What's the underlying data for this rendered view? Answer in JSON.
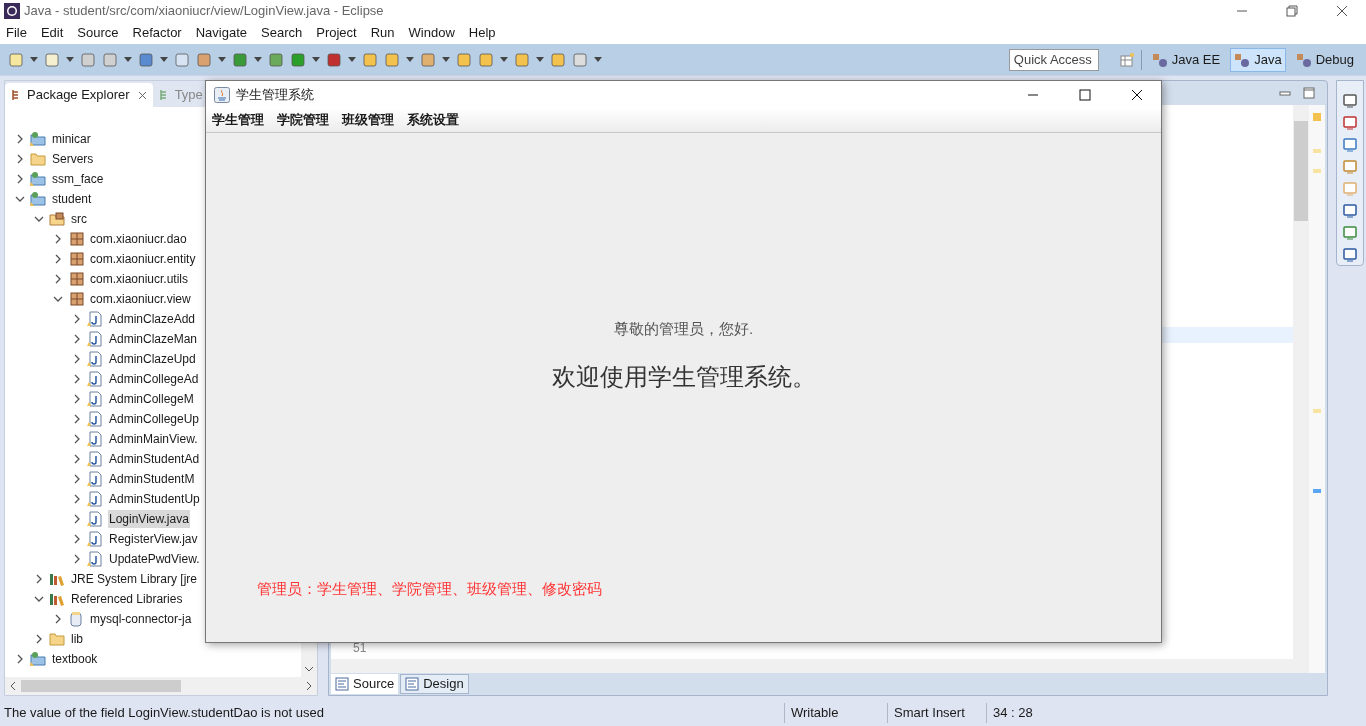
{
  "window": {
    "title": "Java - student/src/com/xiaoniucr/view/LoginView.java - Eclipse"
  },
  "menu": [
    "File",
    "Edit",
    "Source",
    "Refactor",
    "Navigate",
    "Search",
    "Project",
    "Run",
    "Window",
    "Help"
  ],
  "quick_access": {
    "placeholder": "Quick Access"
  },
  "perspectives": [
    {
      "label": "Java EE",
      "selected": false
    },
    {
      "label": "Java",
      "selected": true
    },
    {
      "label": "Debug",
      "selected": false
    }
  ],
  "package_explorer": {
    "tabs": [
      {
        "label": "Package Explorer",
        "selected": true
      },
      {
        "label": "Type",
        "selected": false
      }
    ],
    "tree": [
      {
        "label": "minicar",
        "kind": "project",
        "expanded": false,
        "selected": false
      },
      {
        "label": "Servers",
        "kind": "folder",
        "expanded": false,
        "selected": false
      },
      {
        "label": "ssm_face",
        "kind": "project",
        "expanded": false,
        "selected": false
      },
      {
        "label": "student",
        "kind": "project",
        "expanded": true,
        "selected": false,
        "children": [
          {
            "label": "src",
            "kind": "source_folder",
            "expanded": true,
            "selected": false,
            "children": [
              {
                "label": "com.xiaoniucr.dao",
                "kind": "package",
                "expanded": false,
                "selected": false
              },
              {
                "label": "com.xiaoniucr.entity",
                "kind": "package",
                "expanded": false,
                "selected": false
              },
              {
                "label": "com.xiaoniucr.utils",
                "kind": "package",
                "expanded": false,
                "selected": false
              },
              {
                "label": "com.xiaoniucr.view",
                "kind": "package",
                "expanded": true,
                "selected": false,
                "children": [
                  {
                    "label": "AdminClazeAdd",
                    "kind": "java_file",
                    "expanded": false,
                    "selected": false
                  },
                  {
                    "label": "AdminClazeMan",
                    "kind": "java_file",
                    "expanded": false,
                    "selected": false
                  },
                  {
                    "label": "AdminClazeUpd",
                    "kind": "java_file",
                    "expanded": false,
                    "selected": false
                  },
                  {
                    "label": "AdminCollegeAd",
                    "kind": "java_file",
                    "expanded": false,
                    "selected": false
                  },
                  {
                    "label": "AdminCollegeM",
                    "kind": "java_file",
                    "expanded": false,
                    "selected": false
                  },
                  {
                    "label": "AdminCollegeUp",
                    "kind": "java_file",
                    "expanded": false,
                    "selected": false
                  },
                  {
                    "label": "AdminMainView.",
                    "kind": "java_file",
                    "expanded": false,
                    "selected": false
                  },
                  {
                    "label": "AdminStudentAd",
                    "kind": "java_file",
                    "expanded": false,
                    "selected": false
                  },
                  {
                    "label": "AdminStudentM",
                    "kind": "java_file",
                    "expanded": false,
                    "selected": false
                  },
                  {
                    "label": "AdminStudentUp",
                    "kind": "java_file",
                    "expanded": false,
                    "selected": false
                  },
                  {
                    "label": "LoginView.java",
                    "kind": "java_file",
                    "expanded": false,
                    "selected": true
                  },
                  {
                    "label": "RegisterView.jav",
                    "kind": "java_file",
                    "expanded": false,
                    "selected": false
                  },
                  {
                    "label": "UpdatePwdView.",
                    "kind": "java_file",
                    "expanded": false,
                    "selected": false
                  }
                ]
              }
            ]
          },
          {
            "label": "JRE System Library [jre",
            "kind": "library",
            "expanded": false,
            "selected": false
          },
          {
            "label": "Referenced Libraries",
            "kind": "library",
            "expanded": true,
            "selected": false,
            "children": [
              {
                "label": "mysql-connector-ja",
                "kind": "jar",
                "expanded": false,
                "selected": false
              }
            ]
          },
          {
            "label": "lib",
            "kind": "folder",
            "expanded": false,
            "selected": false
          }
        ]
      },
      {
        "label": "textbook",
        "kind": "project",
        "expanded": false,
        "selected": false
      }
    ]
  },
  "editor": {
    "line_number": "51",
    "tabs": [
      {
        "label": "Source",
        "selected": true
      },
      {
        "label": "Design",
        "selected": false
      }
    ]
  },
  "status_bar": {
    "message": "The value of the field LoginView.studentDao is not used",
    "mode": "Writable",
    "insert": "Smart Insert",
    "position": "34 : 28"
  },
  "dialog": {
    "title": "学生管理系统",
    "menu": [
      "学生管理",
      "学院管理",
      "班级管理",
      "系统设置"
    ],
    "greeting": "尊敬的管理员，您好.",
    "welcome": "欢迎使用学生管理系统。",
    "permissions": "管理员：学生管理、学院管理、班级管理、修改密码"
  }
}
